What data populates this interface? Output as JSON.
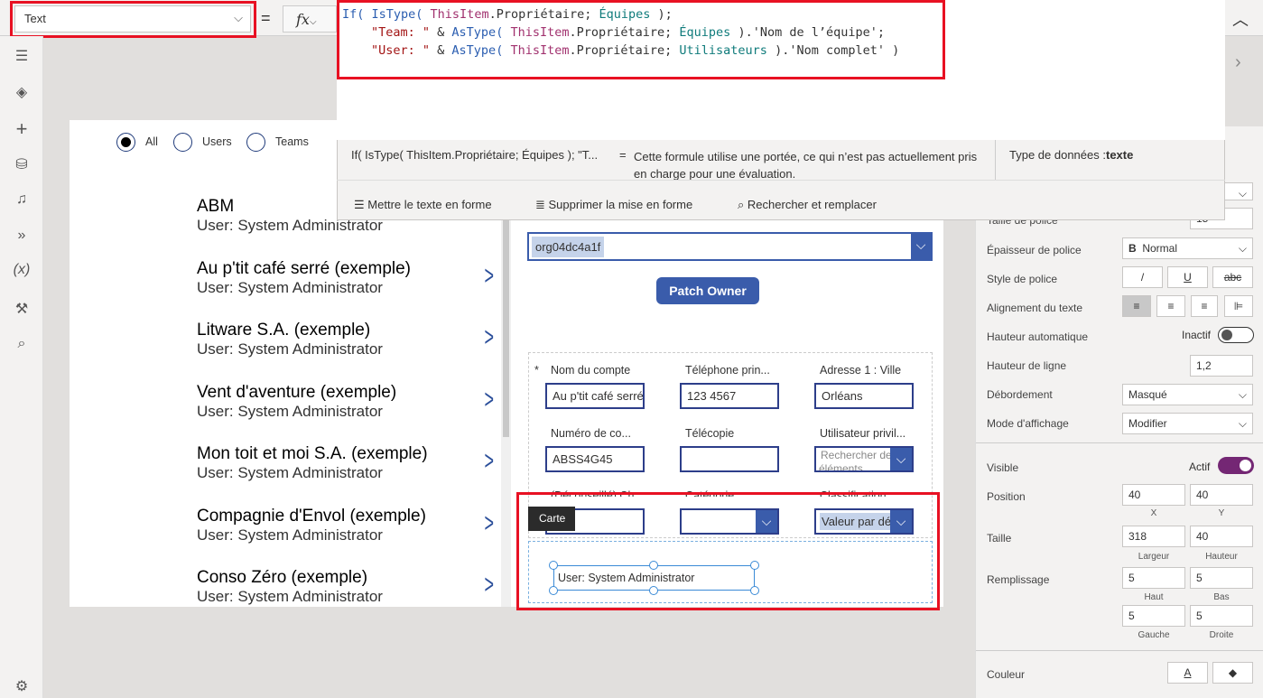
{
  "topbar": {
    "property": "Text",
    "equals": "=",
    "fx": "fx"
  },
  "formula": {
    "lines": [
      [
        "If( ",
        "IsType( ",
        "ThisItem",
        ".Propriétaire; ",
        "Équipes",
        " );"
      ],
      [
        "\"Team: \"",
        " & ",
        "AsType( ",
        "ThisItem",
        ".Propriétaire; ",
        "Équipes",
        " ).'Nom de l’équipe';"
      ],
      [
        "\"User: \"",
        " & ",
        "AsType( ",
        "ThisItem",
        ".Propriétaire; ",
        "Utilisateurs",
        " ).'Nom complet' )"
      ]
    ],
    "preview": "If( IsType( ThisItem.Propriétaire; Équipes ); \"T...",
    "eq": "=",
    "message": "Cette formule utilise une portée, ce qui n’est pas actuellement pris en charge pour une évaluation.",
    "type_label": "Type de données :",
    "type_value": "texte",
    "actions": [
      "Mettre le texte en forme",
      "Supprimer la mise en forme",
      "Rechercher et remplacer"
    ]
  },
  "filter": {
    "options": [
      "All",
      "Users",
      "Teams"
    ],
    "selected": "All"
  },
  "list": [
    {
      "title": "ABM",
      "sub": "User: System Administrator"
    },
    {
      "title": "Au p'tit café serré (exemple)",
      "sub": "User: System Administrator"
    },
    {
      "title": "Litware S.A. (exemple)",
      "sub": "User: System Administrator"
    },
    {
      "title": "Vent d'aventure (exemple)",
      "sub": "User: System Administrator"
    },
    {
      "title": "Mon toit et moi S.A. (exemple)",
      "sub": "User: System Administrator"
    },
    {
      "title": "Compagnie d'Envol (exemple)",
      "sub": "User: System Administrator"
    },
    {
      "title": "Conso Zéro (exemple)",
      "sub": "User: System Administrator"
    }
  ],
  "form": {
    "owner": "org04dc4a1f",
    "patch": "Patch Owner",
    "required": "*",
    "fields": [
      {
        "label": "Nom du compte",
        "value": "Au p'tit café serré"
      },
      {
        "label": "Téléphone prin...",
        "value": "123 4567"
      },
      {
        "label": "Adresse 1 : Ville",
        "value": "Orléans"
      },
      {
        "label": "Numéro de co...",
        "value": "ABSS4G45"
      },
      {
        "label": "Télécopie",
        "value": ""
      },
      {
        "label": "Utilisateur privil...",
        "value": "Rechercher des éléments"
      },
      {
        "label": "(Déconseillé) Ch...",
        "value": ""
      },
      {
        "label": "Catégorie",
        "value": ""
      },
      {
        "label": "Classification",
        "value": "Valeur par dé"
      }
    ],
    "tooltip": "Carte",
    "selected_label": "User: System Administrator"
  },
  "panel": {
    "font_size_label": "Taille de police",
    "font_size": "15",
    "weight_label": "Épaisseur de police",
    "weight": "Normal",
    "weight_icon": "B",
    "style_label": "Style de police",
    "align_label": "Alignement du texte",
    "autoheight_label": "Hauteur automatique",
    "autoheight": "Inactif",
    "lineheight_label": "Hauteur de ligne",
    "lineheight": "1,2",
    "overflow_label": "Débordement",
    "overflow": "Masqué",
    "mode_label": "Mode d'affichage",
    "mode": "Modifier",
    "visible_label": "Visible",
    "visible": "Actif",
    "position_label": "Position",
    "x": "40",
    "y": "40",
    "x_cap": "X",
    "y_cap": "Y",
    "size_label": "Taille",
    "w": "318",
    "h": "40",
    "w_cap": "Largeur",
    "h_cap": "Hauteur",
    "padding_label": "Remplissage",
    "top": "5",
    "bottom": "5",
    "left": "5",
    "right": "5",
    "top_cap": "Haut",
    "bottom_cap": "Bas",
    "left_cap": "Gauche",
    "right_cap": "Droite",
    "color_label": "Couleur",
    "toggle_color": "#742774"
  }
}
